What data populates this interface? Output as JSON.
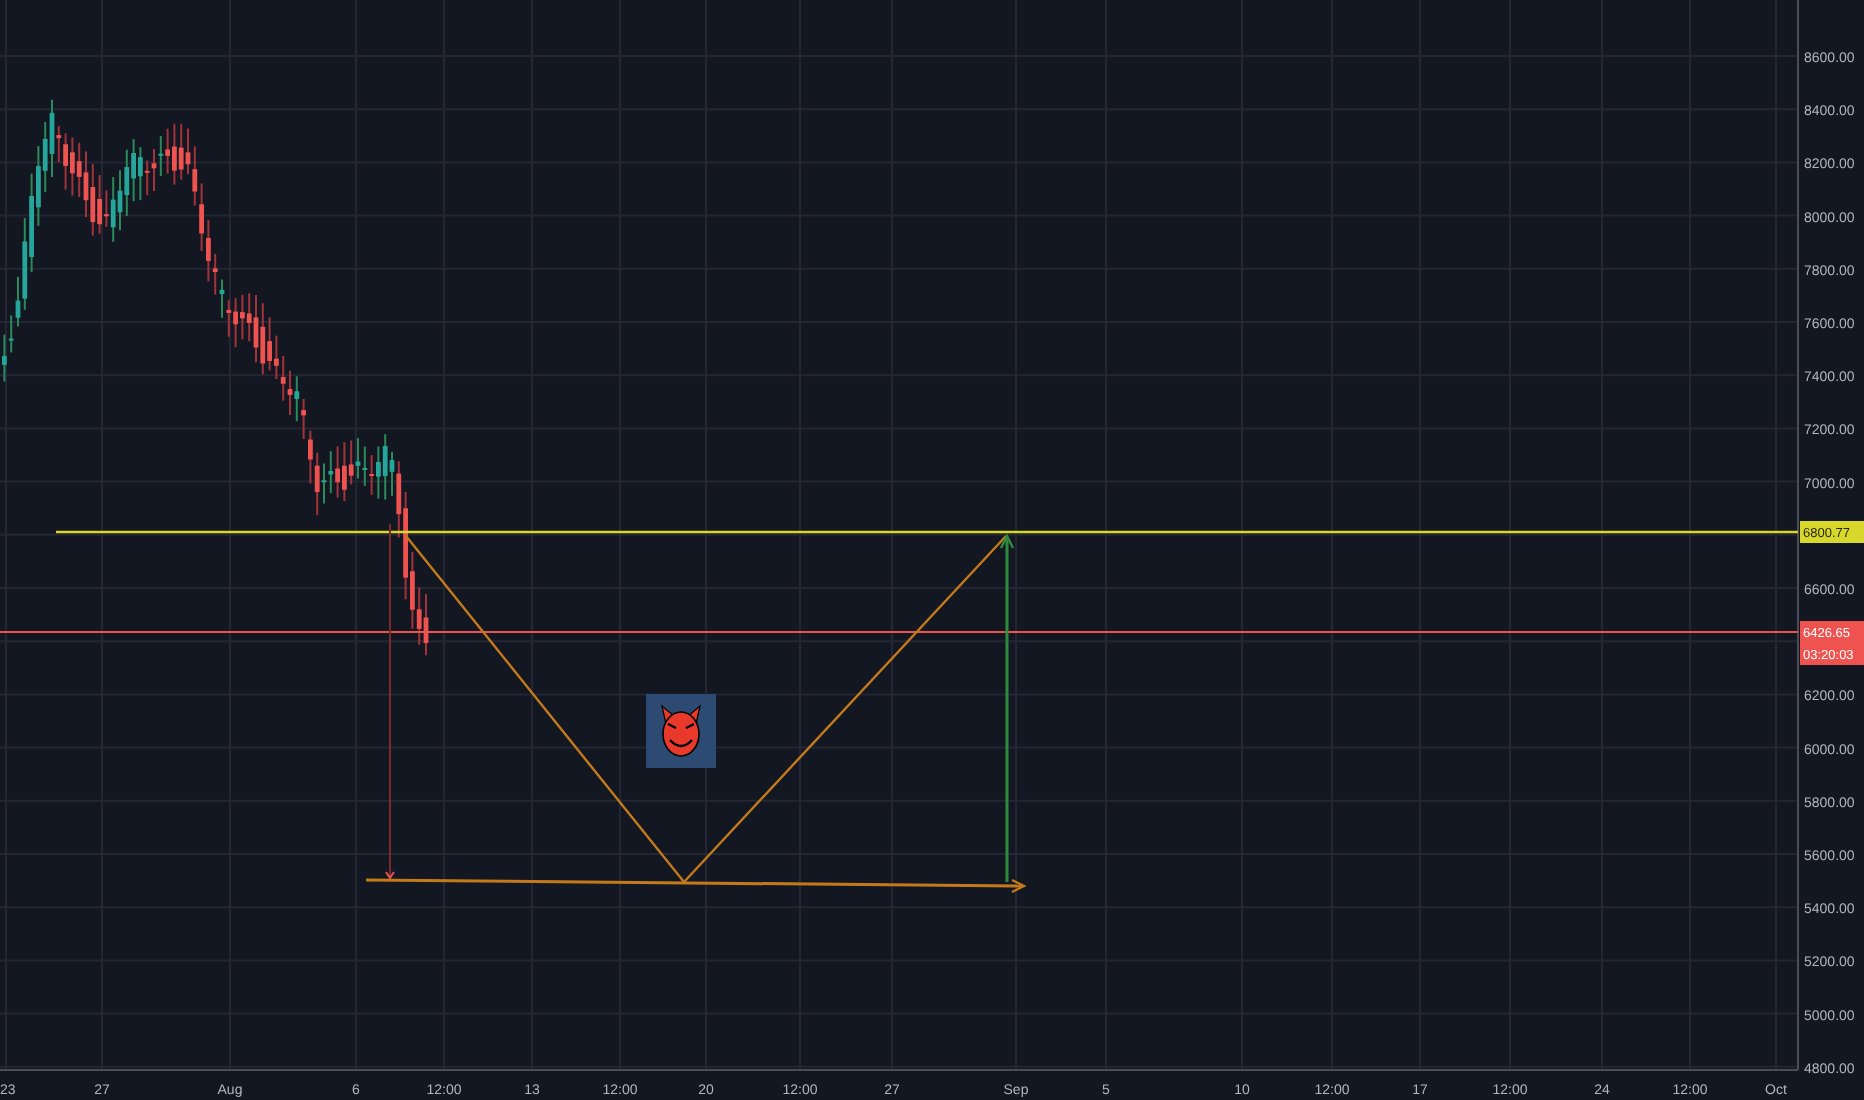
{
  "price_axis": {
    "labels": [
      "8600.00",
      "8400.00",
      "8200.00",
      "8000.00",
      "7800.00",
      "7600.00",
      "7400.00",
      "7200.00",
      "7000.00",
      "6600.00",
      "6200.00",
      "6000.00",
      "5800.00",
      "5600.00",
      "5400.00",
      "5200.00",
      "5000.00",
      "4800.00"
    ]
  },
  "time_axis": {
    "labels": [
      "23",
      "27",
      "Aug",
      "6",
      "12:00",
      "13",
      "12:00",
      "20",
      "12:00",
      "27",
      "Sep",
      "5",
      "10",
      "12:00",
      "17",
      "12:00",
      "24",
      "12:00",
      "Oct"
    ]
  },
  "price_markers": [
    {
      "text": "6800.77",
      "color": "#d8d82c"
    },
    {
      "text": "6426.65",
      "color": "#ef5350"
    },
    {
      "text": "03:20:03",
      "color": "#ef5350"
    }
  ]
}
